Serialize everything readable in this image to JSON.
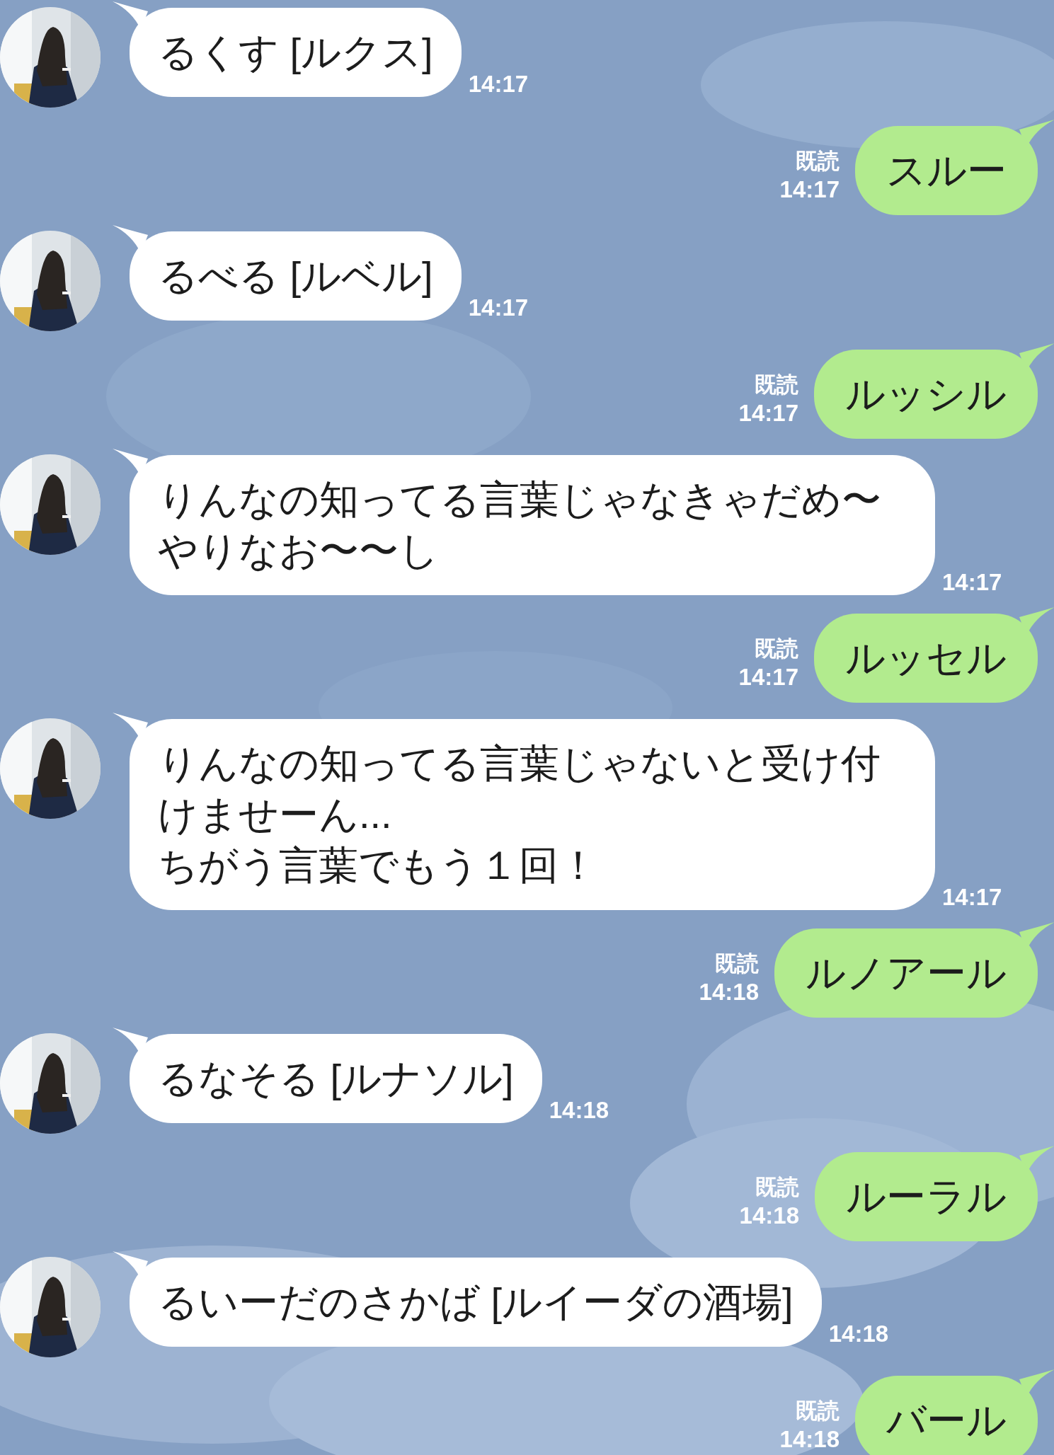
{
  "messages": [
    {
      "kind": "received",
      "text": "るくす [ルクス]",
      "time": "14:17"
    },
    {
      "kind": "sent",
      "text": "スルー",
      "read": "既読",
      "time": "14:17"
    },
    {
      "kind": "received",
      "text": "るべる [ルベル]",
      "time": "14:17"
    },
    {
      "kind": "sent",
      "text": "ルッシル",
      "read": "既読",
      "time": "14:17"
    },
    {
      "kind": "received",
      "text": "りんなの知ってる言葉じゃなきゃだめ〜やりなお〜〜し",
      "time": "14:17"
    },
    {
      "kind": "sent",
      "text": "ルッセル",
      "read": "既読",
      "time": "14:17"
    },
    {
      "kind": "received",
      "text": "りんなの知ってる言葉じゃないと受け付けませーん...\nちがう言葉でもう１回！",
      "time": "14:17"
    },
    {
      "kind": "sent",
      "text": "ルノアール",
      "read": "既読",
      "time": "14:18"
    },
    {
      "kind": "received",
      "text": "るなそる [ルナソル]",
      "time": "14:18"
    },
    {
      "kind": "sent",
      "text": "ルーラル",
      "read": "既読",
      "time": "14:18"
    },
    {
      "kind": "received",
      "text": "るいーだのさかば [ルイーダの酒場]",
      "time": "14:18"
    },
    {
      "kind": "sent",
      "text": "バール",
      "read": "既読",
      "time": "14:18"
    }
  ]
}
